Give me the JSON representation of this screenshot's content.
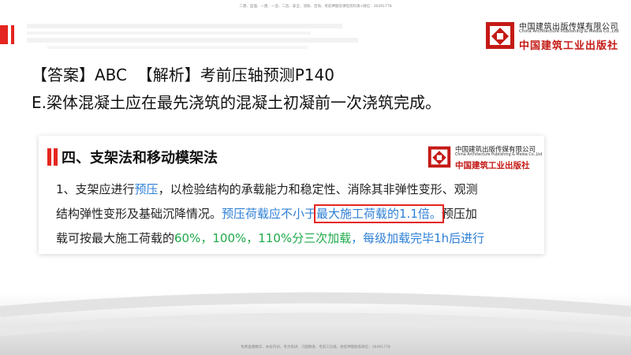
{
  "header": {
    "watermark_top": "二建、监理、一建、一造、二造、安全、消防、咨询、考前押题及课程资料请+微信：36491778",
    "logo": {
      "name_cn": "中国建筑出版传媒有限公司",
      "name_en": "China Architecture Publishing & Media Co.,Ltd",
      "brand_cn": "中国建筑工业出版社"
    }
  },
  "answer": {
    "answer_label": "【答案】ABC",
    "analysis_label": "【解析】考前压轴预测P140"
  },
  "option_e": "E.梁体混凝土应在最先浇筑的混凝土初凝前一次浇筑完成。",
  "card": {
    "heading": "四、支架法和移动模架法",
    "logo": {
      "name_cn": "中国建筑出版传媒有限公司",
      "name_en": "China Architecture Publishing & Media Co.,Ltd",
      "brand_cn": "中国建筑工业出版社"
    },
    "line1": {
      "part1": "1、支架应进行",
      "part2": "预压",
      "part3": "，以检验结构的承载能力和稳定性、消除其非弹性变形、观测"
    },
    "line2": {
      "part1": "结构弹性变形及基础沉降情况。",
      "part2": "预压荷载应不小于",
      "part3": "最大施工荷载的1.1倍。",
      "part4": "预压加"
    },
    "line3": {
      "part1": "载可按最大施工荷载的",
      "part2": "60%，100%，110%分三次加载",
      "part3": "，每级加载完毕1h后进行"
    }
  },
  "footer": {
    "watermark_bottom": "免费直播精华、本会内训、考点串讲、习题精讲、考前三页纸、绝密押题联系微信：36491778"
  },
  "colors": {
    "accent_red": "#e5251f",
    "highlight_blue": "#2e7fd6",
    "highlight_green": "#1faa4a"
  }
}
